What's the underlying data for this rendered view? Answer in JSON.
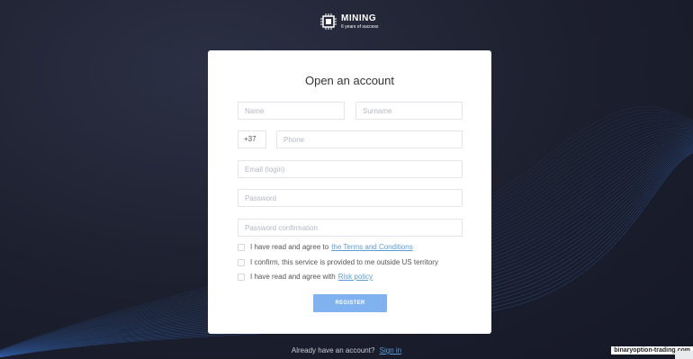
{
  "brand": {
    "name": "MINING",
    "tagline": "6 years of success"
  },
  "form": {
    "title": "Open an account",
    "name_placeholder": "Name",
    "surname_placeholder": "Surname",
    "phone_prefix": "+37",
    "phone_placeholder": "Phone",
    "email_placeholder": "Email (login)",
    "password_placeholder": "Password",
    "password_confirm_placeholder": "Password confirmation",
    "terms_text": "I have read and agree to",
    "terms_link": "the Terms and Conditions",
    "confirm_text": "I confirm, this service is provided to me outside US territory",
    "risk_text": "I have read and agree with",
    "risk_link": "Risk policy",
    "register_label": "REGISTER"
  },
  "footer": {
    "already_text": "Already have an account?",
    "signin_link": "Sign in",
    "watermark": "binaryoption-trading.com"
  },
  "colors": {
    "background": "#1c1f2d",
    "card": "#ffffff",
    "accent_button": "#7fb2ee",
    "link": "#5a9cd8",
    "wave": "#3f7fe0"
  }
}
